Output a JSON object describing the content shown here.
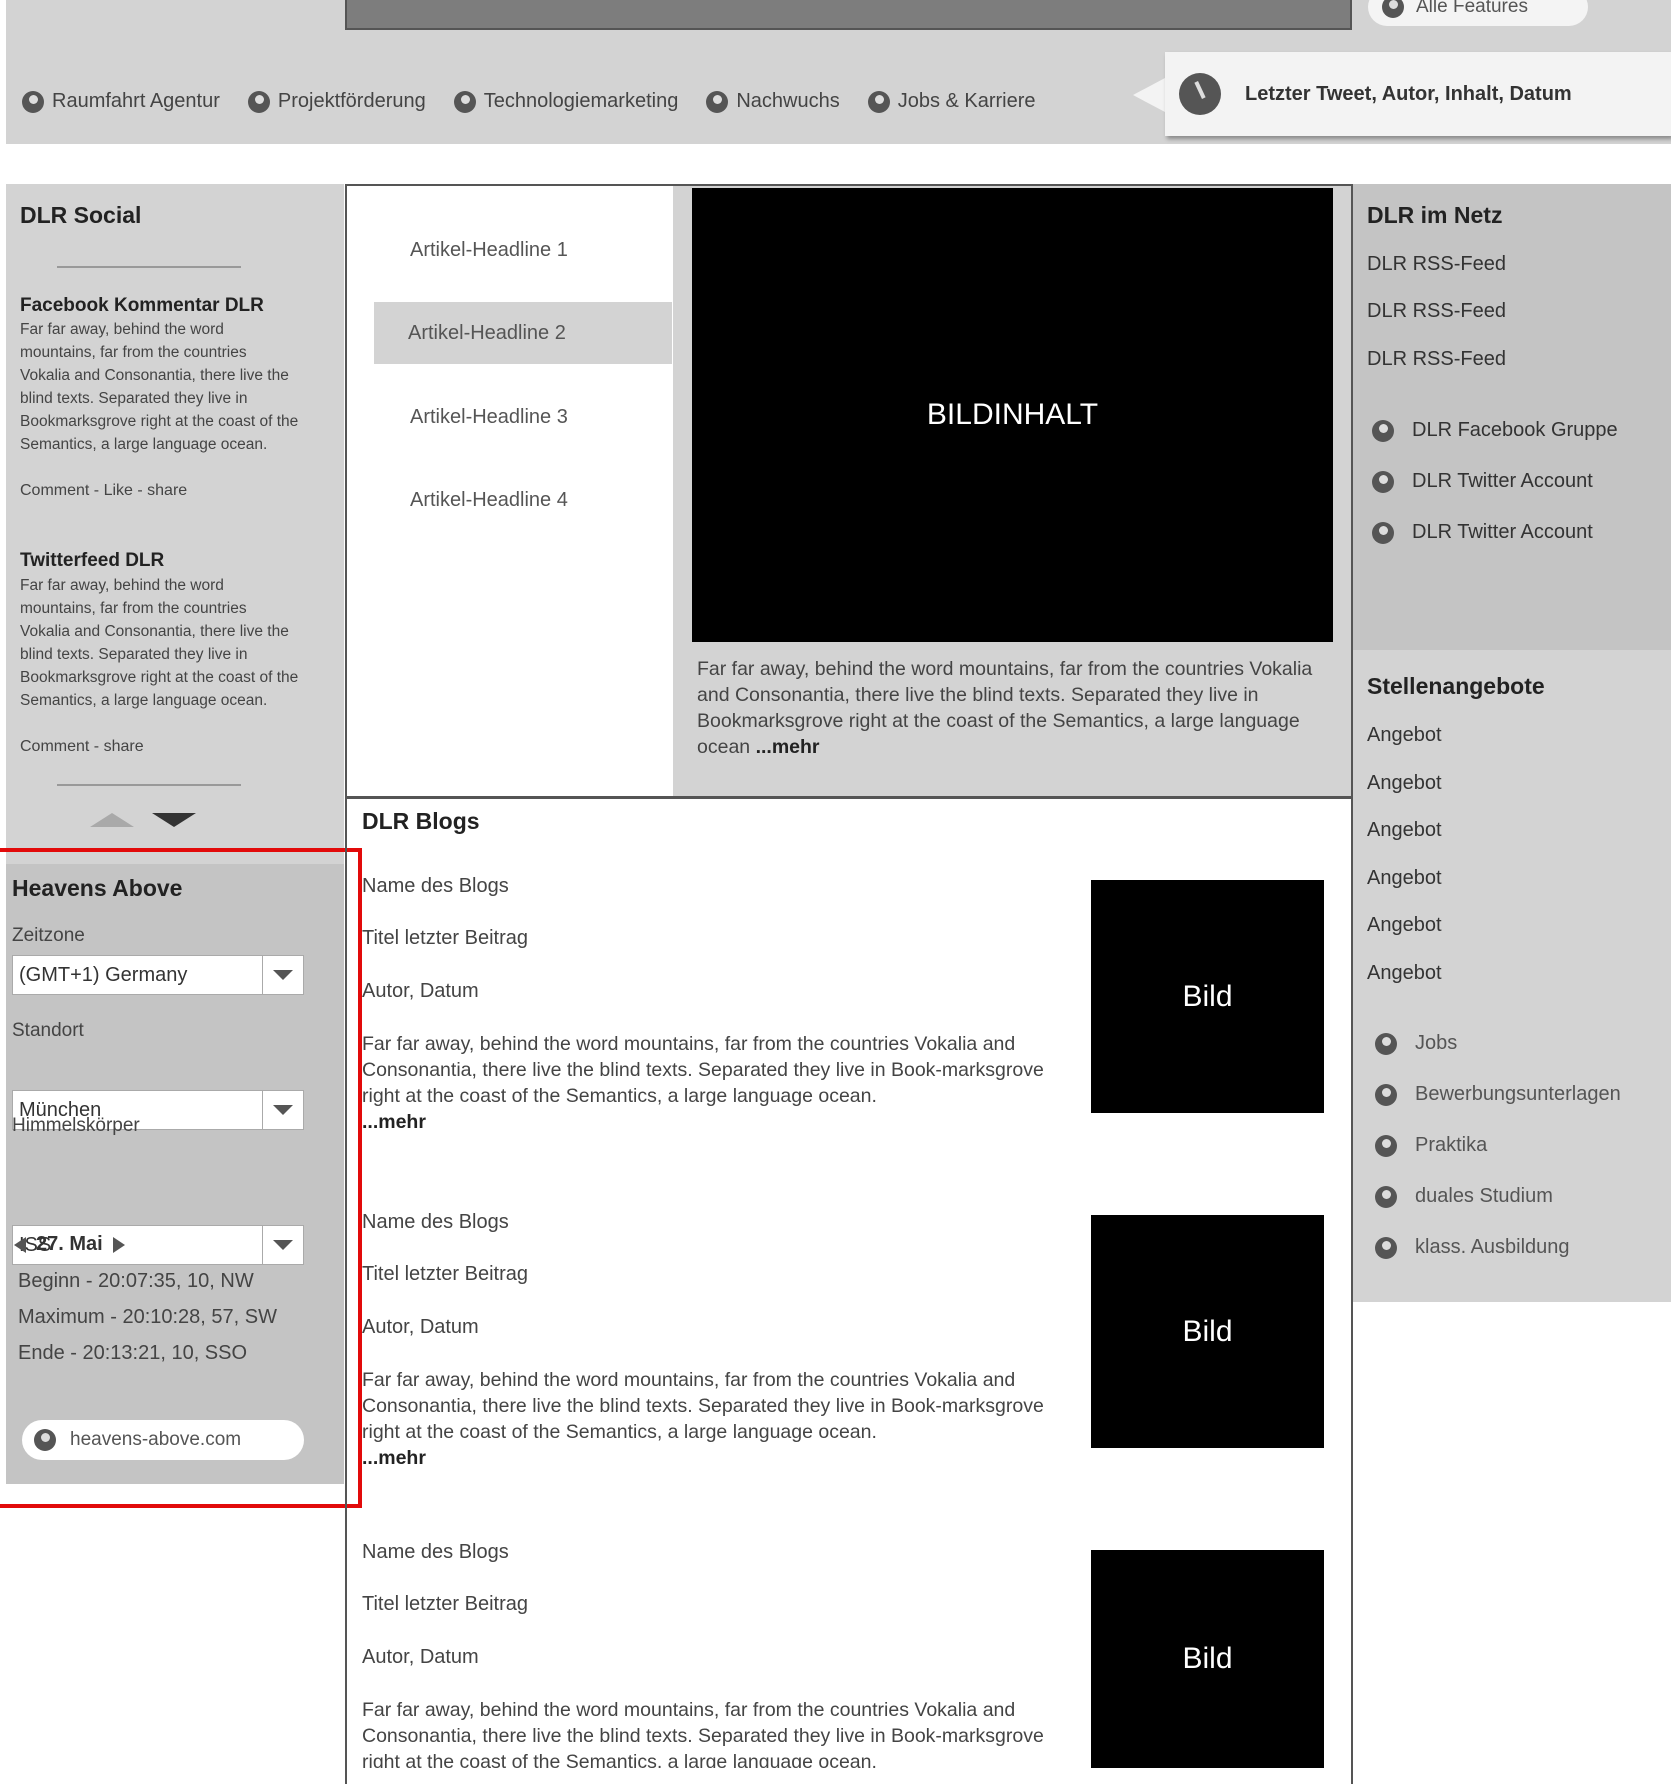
{
  "header": {
    "features_label": "Alle Features",
    "nav": [
      "Raumfahrt Agentur",
      "Projektförderung",
      "Technologiemarketing",
      "Nachwuchs",
      "Jobs & Karriere"
    ],
    "tweet": "Letzter Tweet, Autor, Inhalt, Datum"
  },
  "social": {
    "title": "DLR Social",
    "facebook": {
      "heading": "Facebook Kommentar DLR",
      "lines": [
        "Far far away, behind the word",
        "mountains, far from the countries",
        "Vokalia and Consonantia, there live the",
        "blind texts. Separated they live in",
        "Bookmarksgrove right at the coast of the",
        "Semantics, a large language ocean."
      ],
      "actions": "Comment - Like - share"
    },
    "twitter": {
      "heading": "Twitterfeed DLR",
      "lines": [
        "Far far away, behind the word",
        "mountains, far from the countries",
        "Vokalia and Consonantia, there live the",
        "blind texts. Separated they live in",
        "Bookmarksgrove right at the coast of the",
        "Semantics, a large language ocean."
      ],
      "actions": "Comment -  share"
    }
  },
  "heavens": {
    "title": "Heavens Above",
    "zeitzone_label": "Zeitzone",
    "zeitzone_value": "(GMT+1) Germany",
    "standort_label": "Standort",
    "standort_value": "München",
    "himmel_label": "Himmelskörper",
    "himmel_value": "ISS",
    "date": "27. Mai",
    "beginn": "Beginn  -  20:07:35, 10, NW",
    "maximum": "Maximum  -  20:10:28, 57, SW",
    "ende": "Ende  -  20:13:21, 10, SSO",
    "site": "heavens-above.com"
  },
  "articles": {
    "headlines": [
      "Artikel-Headline 1",
      "Artikel-Headline 2",
      "Artikel-Headline 3",
      "Artikel-Headline 4"
    ],
    "image_label": "BILDINHALT",
    "caption": "Far far away, behind the word mountains, far from the countries Vokalia and Consonantia, there live the blind texts. Separated they live in Bookmarksgrove right at the coast of the Semantics, a large language ocean",
    "more": "...mehr"
  },
  "blogs": {
    "title": "DLR Blogs",
    "items": [
      {
        "name": "Name des Blogs",
        "post": "Titel letzter Beitrag",
        "author": "Autor, Datum",
        "body": "Far far away, behind the word mountains, far from the countries Vokalia and Consonantia, there live the blind texts. Separated they live in Book-marksgrove right at the coast of the Semantics, a large language ocean.",
        "more": "...mehr",
        "image": "Bild"
      },
      {
        "name": "Name des Blogs",
        "post": "Titel letzter Beitrag",
        "author": "Autor, Datum",
        "body": "Far far away, behind the word mountains, far from the countries Vokalia and Consonantia, there live the blind texts. Separated they live in Book-marksgrove right at the coast of the Semantics, a large language ocean.",
        "more": "...mehr",
        "image": "Bild"
      },
      {
        "name": "Name des Blogs",
        "post": "Titel letzter Beitrag",
        "author": "Autor, Datum",
        "body": "Far far away, behind the word mountains, far from the countries Vokalia and Consonantia, there live the blind texts. Separated they live in Book-marksgrove right at the coast of the Semantics, a large language ocean.",
        "more": "",
        "image": "Bild"
      }
    ]
  },
  "netz": {
    "title": "DLR im Netz",
    "feeds": [
      "DLR RSS-Feed",
      "DLR RSS-Feed",
      "DLR RSS-Feed"
    ],
    "accounts": [
      "DLR Facebook Gruppe",
      "DLR Twitter Account",
      "DLR Twitter Account"
    ]
  },
  "stellen": {
    "title": "Stellenangebote",
    "offers": [
      "Angebot",
      "Angebot",
      "Angebot",
      "Angebot",
      "Angebot",
      "Angebot"
    ],
    "links": [
      "Jobs",
      "Bewerbungsunterlagen",
      "Praktika",
      "duales Studium",
      "klass. Ausbildung"
    ]
  }
}
